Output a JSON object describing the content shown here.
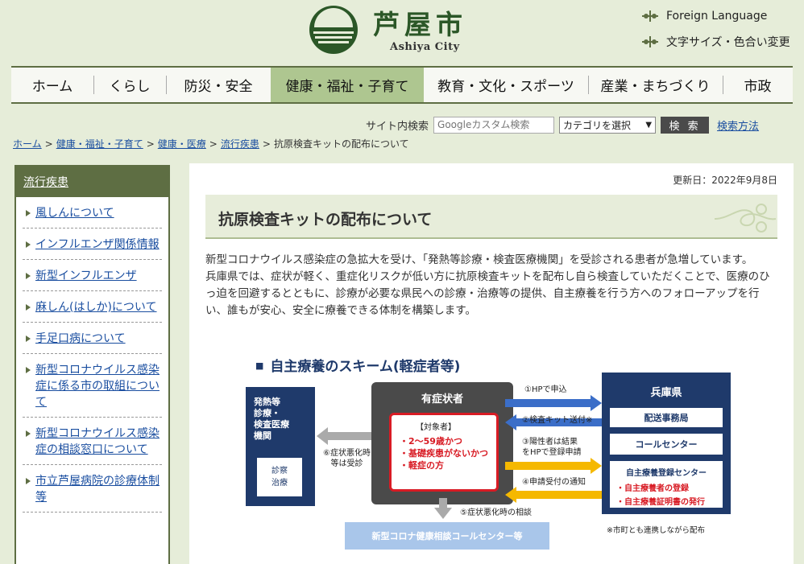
{
  "header": {
    "city_name_jp": "芦屋市",
    "city_name_en": "Ashiya City",
    "links": [
      {
        "label": "Foreign Language"
      },
      {
        "label": "文字サイズ・色合い変更"
      }
    ]
  },
  "nav": [
    {
      "label": "ホーム",
      "active": false
    },
    {
      "label": "くらし",
      "active": false
    },
    {
      "label": "防災・安全",
      "active": false
    },
    {
      "label": "健康・福祉・子育て",
      "active": true
    },
    {
      "label": "教育・文化・スポーツ",
      "active": false
    },
    {
      "label": "産業・まちづくり",
      "active": false
    },
    {
      "label": "市政",
      "active": false
    }
  ],
  "search": {
    "label": "サイト内検索",
    "placeholder": "Googleカスタム検索",
    "category_selected": "カテゴリを選択",
    "button": "検 索",
    "help_link": "検索方法"
  },
  "breadcrumb": {
    "links": [
      "ホーム",
      "健康・福祉・子育て",
      "健康・医療",
      "流行疾患"
    ],
    "current": "抗原検査キットの配布について",
    "separator": ">"
  },
  "sidebar": {
    "title": "流行疾患",
    "items": [
      "風しんについて",
      "インフルエンザ関係情報",
      "新型インフルエンザ",
      "麻しん(はしか)について",
      "手足口病について",
      "新型コロナウイルス感染症に係る市の取組について",
      "新型コロナウイルス感染症の相談窓口について",
      "市立芦屋病院の診療体制等"
    ]
  },
  "main": {
    "updated": "更新日：2022年9月8日",
    "title": "抗原検査キットの配布について",
    "paragraphs": [
      "新型コロナウイルス感染症の急拡大を受け、「発熱等診療・検査医療機関」を受診される患者が急増しています。",
      "兵庫県では、症状が軽く、重症化リスクが低い方に抗原検査キットを配布し自ら検査していただくことで、医療のひっ迫を回避するとともに、診療が必要な県民への診療・治療等の提供、自主療養を行う方へのフォローアップを行い、誰もが安心、安全に療養できる体制を構築します。"
    ]
  },
  "figure": {
    "title": "自主療養のスキーム(軽症者等)",
    "left_box": {
      "title": "発熱等\n診療・\n検査医療\n機関",
      "inner": "診察\n治療"
    },
    "center_box": {
      "title": "有症状者",
      "target_label": "【対象者】",
      "conditions": [
        "・2～59歳かつ",
        "・基礎疾患がないかつ",
        "・軽症の方"
      ]
    },
    "right_box": {
      "title": "兵庫県",
      "rows": [
        "配送事務局",
        "コールセンター",
        "自主療養登録センター"
      ],
      "sub_items": [
        "・自主療養者の登録",
        "・自主療養証明書の発行"
      ]
    },
    "arrows": [
      "①HPで申込",
      "②検査キット送付※",
      "③陽性者は結果\nをHPで登録申請",
      "④申請受付の通知",
      "⑤症状悪化時の相談",
      "⑥症状悪化時\n等は受診"
    ],
    "bottom_box": "新型コロナ健康相談コールセンター等",
    "footnote": "※市町とも連携しながら配布",
    "colors": {
      "navy": "#1f3a6b",
      "gray": "#4a4a4a",
      "blue_arrow": "#3b6ec8",
      "yellow_arrow": "#f5b800",
      "red": "#d81b24",
      "light_blue": "#a9c6ea"
    }
  },
  "theme": {
    "accent_green": "#5e6e43",
    "active_nav": "#aec690",
    "bg": "#e6edd9"
  }
}
